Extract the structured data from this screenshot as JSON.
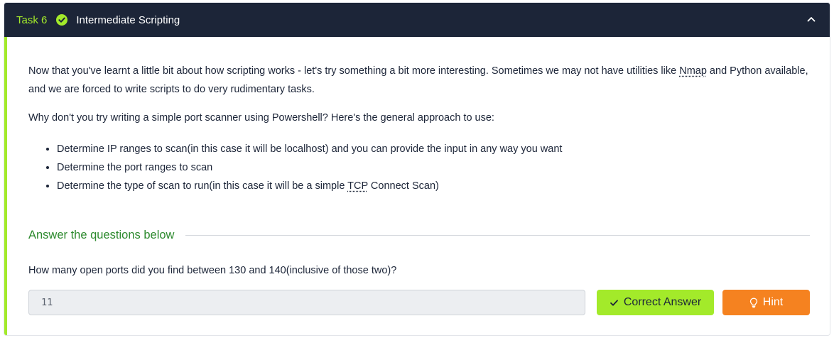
{
  "task": {
    "number": "Task 6",
    "title": "Intermediate Scripting",
    "completed": true,
    "accent_color": "#a3ea2a",
    "header_bg": "#1c2538"
  },
  "content": {
    "p1_before": "Now that you've learnt a little bit about how scripting works - let's try something a bit more interesting. Sometimes we may not have utilities like ",
    "p1_link": "Nmap",
    "p1_after": " and Python available, and we are forced to write scripts to do very rudimentary tasks.",
    "p2": "Why don't you try writing a simple port scanner using Powershell? Here's the general approach to use:",
    "bullets": {
      "b1": "Determine IP ranges to scan(in this case it will be localhost) and you can provide the input in any way you want",
      "b2": "Determine the port ranges to scan",
      "b3_before": "Determine the type of scan to run(in this case it will be a simple ",
      "b3_abbr": "TCP",
      "b3_after": " Connect Scan)"
    }
  },
  "answers": {
    "heading": "Answer the questions below",
    "question": "How many open ports did you find between 130 and 140(inclusive of those two)?",
    "answer_value": "11",
    "correct_label": "Correct Answer",
    "hint_label": "Hint"
  },
  "icons": {
    "completed": "check-circle-icon",
    "collapse": "chevron-up-icon",
    "correct": "check-icon",
    "hint": "lightbulb-icon"
  },
  "colors": {
    "correct_button": "#a3ea2a",
    "hint_button": "#f58220",
    "heading_green": "#2d8a2e"
  }
}
